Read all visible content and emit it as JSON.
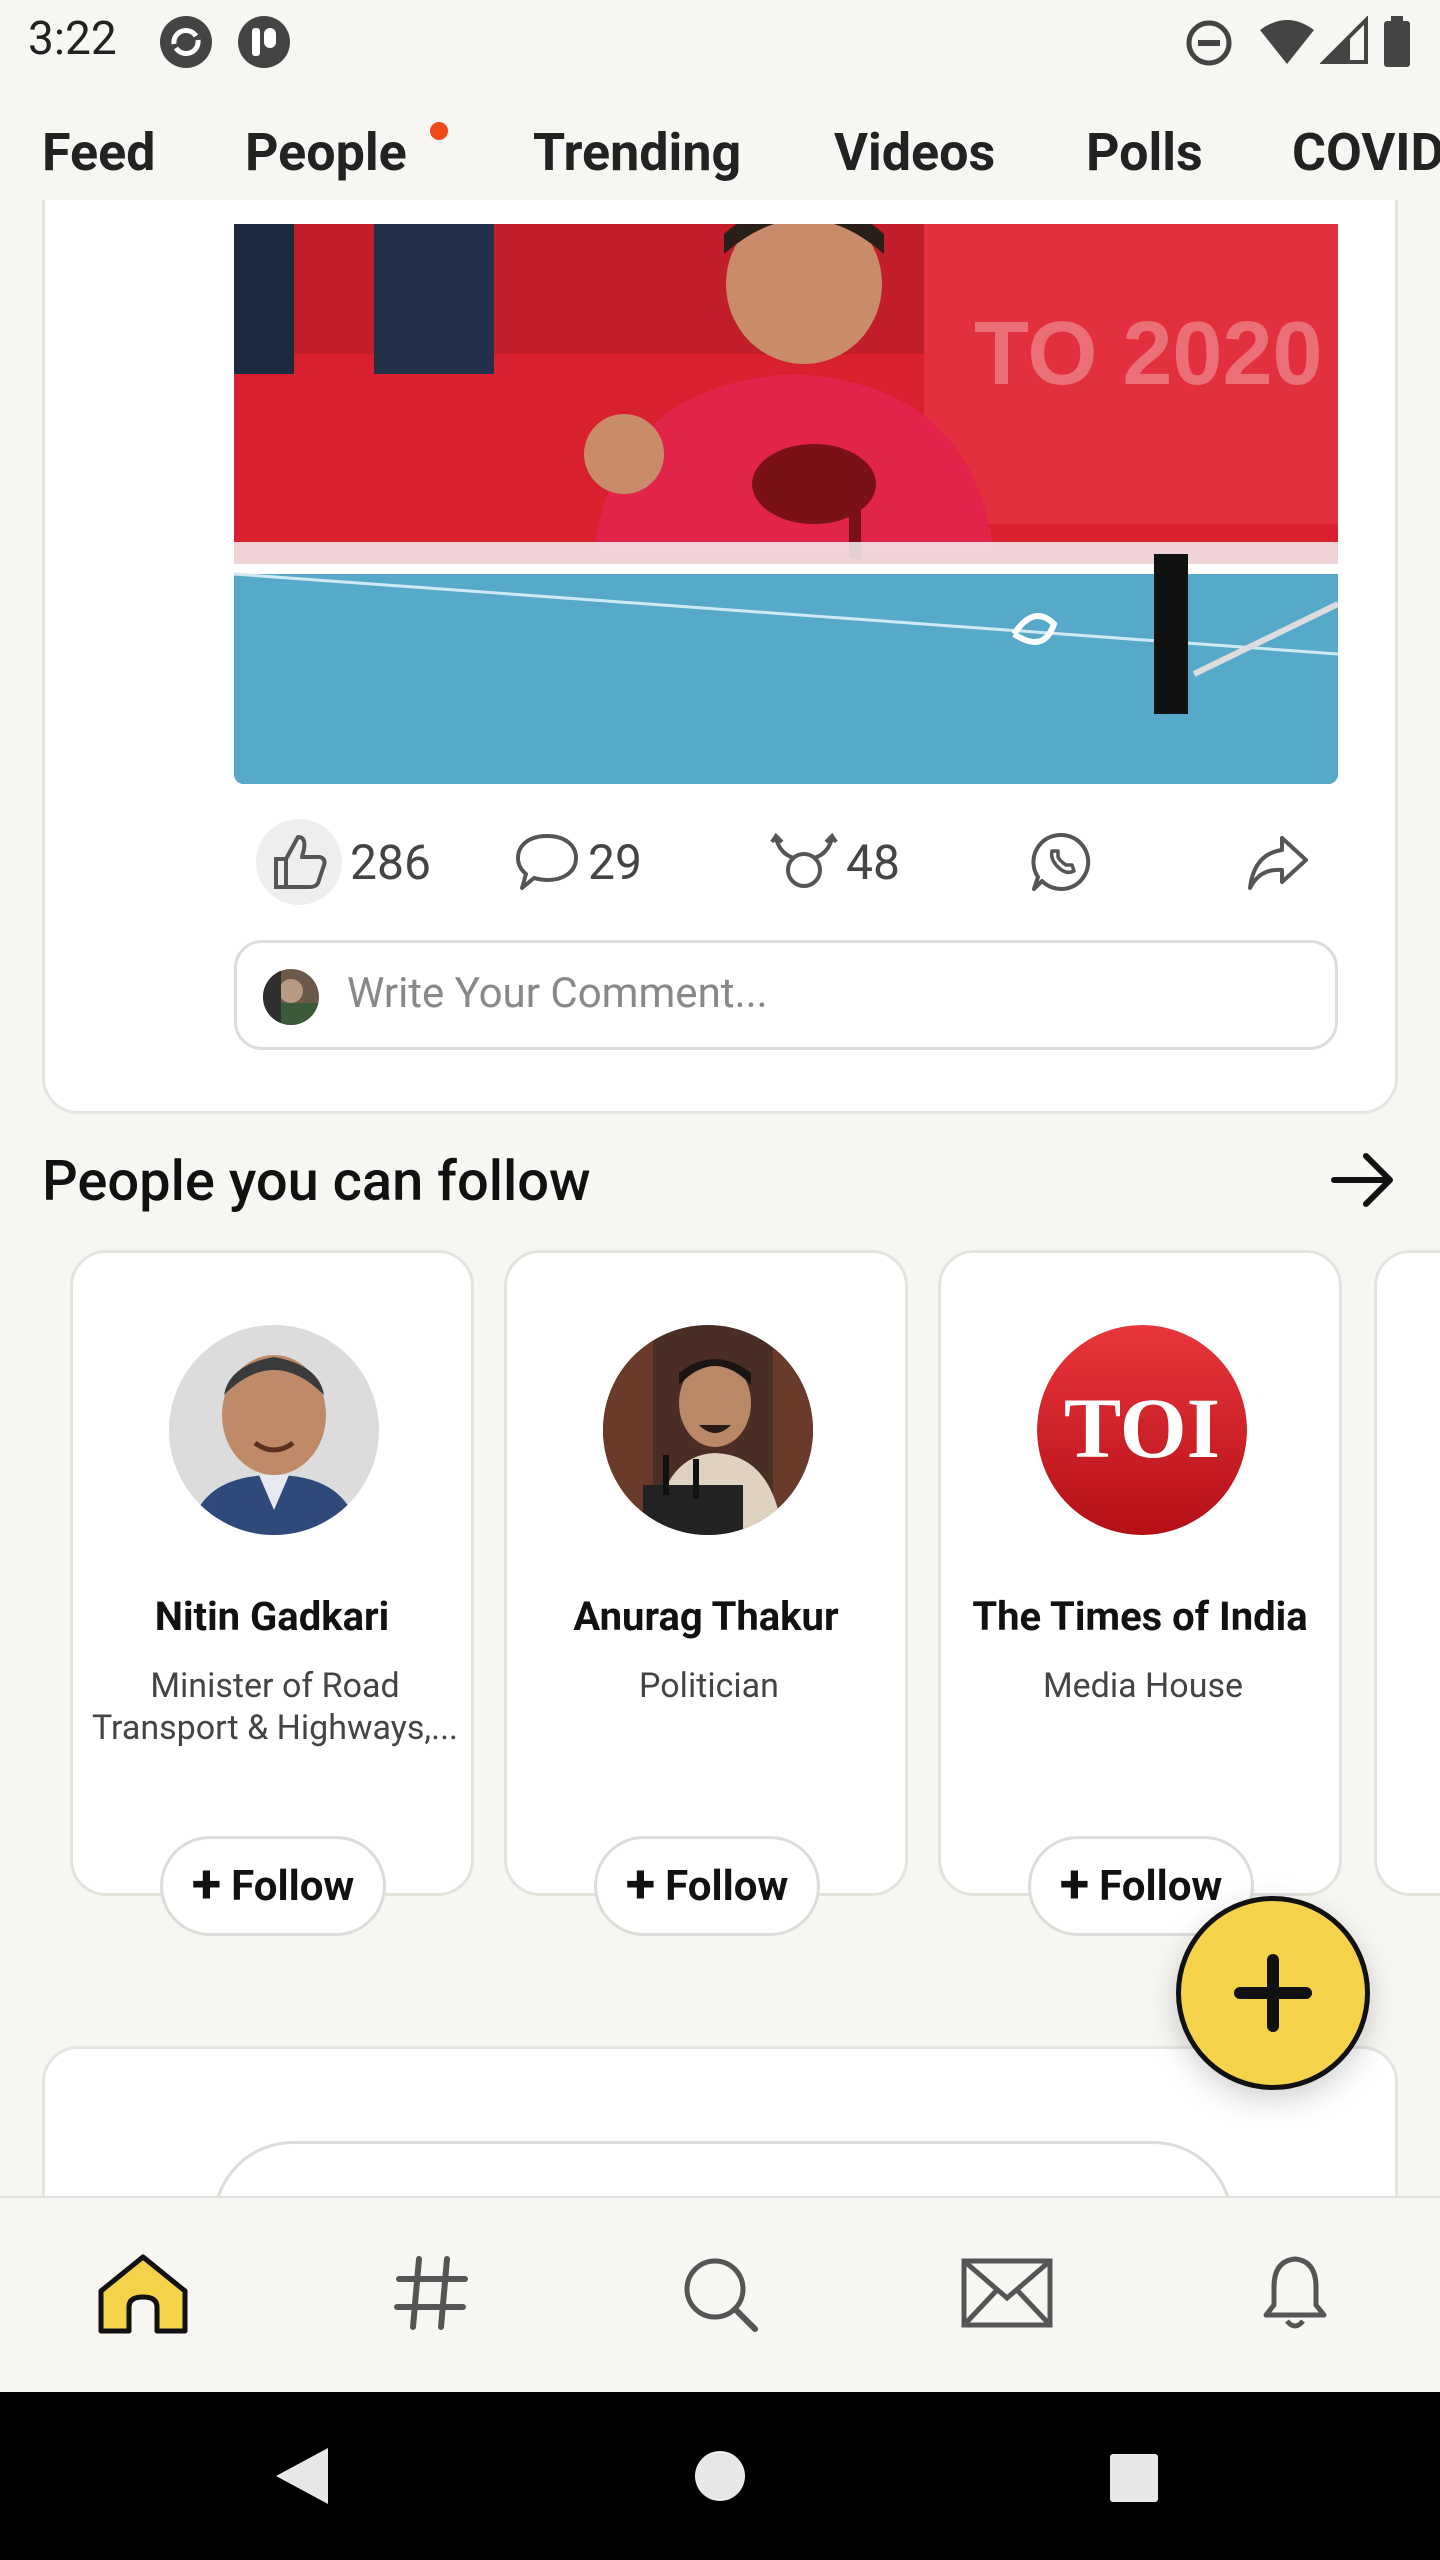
{
  "status_bar": {
    "time": "3:22"
  },
  "tabs": [
    {
      "label": "Feed",
      "active": true
    },
    {
      "label": "People",
      "has_dot": true
    },
    {
      "label": "Trending"
    },
    {
      "label": "Videos"
    },
    {
      "label": "Polls"
    },
    {
      "label": "COVID"
    }
  ],
  "post": {
    "likes": "286",
    "comments": "29",
    "shares": "48",
    "comment_placeholder": "Write Your Comment..."
  },
  "people_section": {
    "title": "People you can follow",
    "people": [
      {
        "name": "Nitin Gadkari",
        "description": "Minister of Road Transport & Highways,...",
        "follow_label": "Follow"
      },
      {
        "name": "Anurag Thakur",
        "description": "Politician",
        "follow_label": "Follow"
      },
      {
        "name": "The Times of India",
        "description": "Media House",
        "follow_label": "Follow",
        "logo_text": "TOI"
      }
    ]
  },
  "bottom_nav": [
    "home-icon",
    "hashtag-icon",
    "search-icon",
    "mail-icon",
    "bell-icon"
  ],
  "colors": {
    "accent": "#f3cf3f",
    "fab": "#f4d24a",
    "notification_dot": "#ef4a18",
    "toi_red": "#d4161c"
  }
}
